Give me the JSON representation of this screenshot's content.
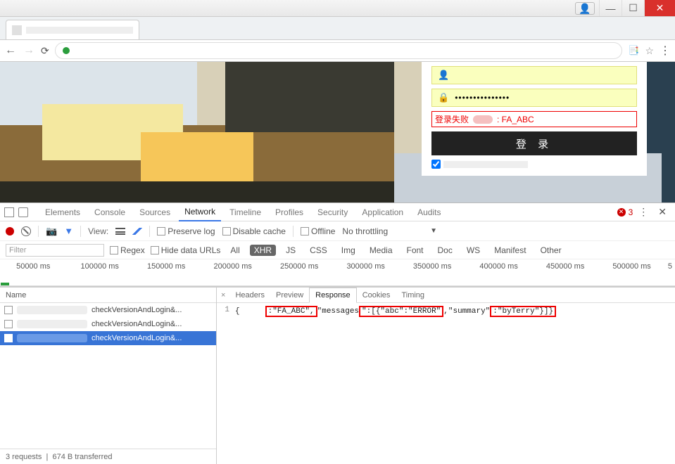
{
  "login": {
    "username_placeholder": "",
    "password_value": "•••••••••••••••",
    "error_prefix": "登录失败",
    "error_code": ": FA_ABC",
    "button_label": "登 录"
  },
  "devtools": {
    "tabs": [
      "Elements",
      "Console",
      "Sources",
      "Network",
      "Timeline",
      "Profiles",
      "Security",
      "Application",
      "Audits"
    ],
    "active_tab": "Network",
    "error_count": "3",
    "toolbar": {
      "view_label": "View:",
      "preserve_log": "Preserve log",
      "disable_cache": "Disable cache",
      "offline": "Offline",
      "throttling": "No throttling"
    },
    "filter": {
      "placeholder": "Filter",
      "regex": "Regex",
      "hide_data_urls": "Hide data URLs",
      "types": [
        "All",
        "XHR",
        "JS",
        "CSS",
        "Img",
        "Media",
        "Font",
        "Doc",
        "WS",
        "Manifest",
        "Other"
      ],
      "active_type": "XHR"
    },
    "timeline_ticks": [
      "50000 ms",
      "100000 ms",
      "150000 ms",
      "200000 ms",
      "250000 ms",
      "300000 ms",
      "350000 ms",
      "400000 ms",
      "450000 ms",
      "500000 ms",
      "5"
    ],
    "requests": {
      "header": "Name",
      "rows": [
        {
          "name": "checkVersionAndLogin&...",
          "selected": false
        },
        {
          "name": "checkVersionAndLogin&...",
          "selected": false
        },
        {
          "name": "checkVersionAndLogin&...",
          "selected": true
        }
      ],
      "footer_requests": "3 requests",
      "footer_sep": "|",
      "footer_transferred": "674 B transferred"
    },
    "detail": {
      "tabs": [
        "Headers",
        "Preview",
        "Response",
        "Cookies",
        "Timing"
      ],
      "active_tab": "Response",
      "line_no": "1",
      "resp_open": "{",
      "resp_blank1": "      ",
      "resp_seg1": ":\"FA_ABC\",",
      "resp_seg2_pre": "\"messages",
      "resp_seg2_mid": "\":[{\"abc\":\"ERROR\"",
      "resp_seg2_post": ",",
      "resp_seg3_pre": "\"summary\"",
      "resp_seg3": ":\"byTerry\"}]}"
    }
  }
}
